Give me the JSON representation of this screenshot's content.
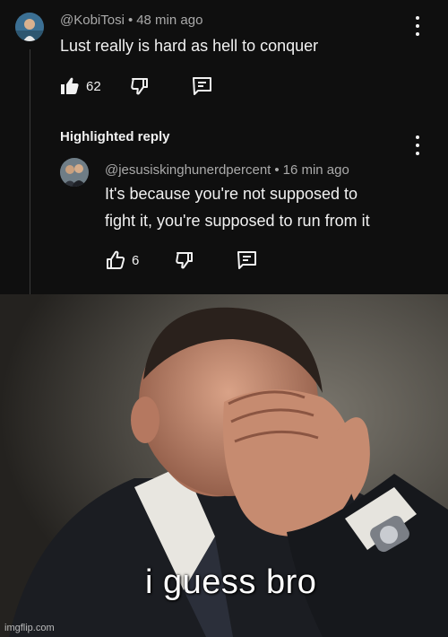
{
  "comment": {
    "author": "@KobiTosi",
    "time": "48 min ago",
    "text": "Lust really is hard as hell to conquer",
    "like_count": "62"
  },
  "highlight_label": "Highlighted reply",
  "reply": {
    "author": "@jesusiskinghunerdpercent",
    "time": "16 min ago",
    "text_line1": "It's because you're not supposed to",
    "text_line2": "fight it, you're supposed to run from it",
    "like_count": "6"
  },
  "meme": {
    "caption": "i guess bro",
    "watermark": "imgflip.com"
  },
  "icons": {
    "like_filled": "thumbs-up-filled-icon",
    "like_outline": "thumbs-up-outline-icon",
    "dislike": "thumbs-down-icon",
    "reply": "reply-bubble-icon",
    "more": "more-vertical-icon"
  },
  "colors": {
    "background": "#0f0f0f",
    "meta_text": "#aaaaaa",
    "primary_text": "#f1f1f1"
  }
}
